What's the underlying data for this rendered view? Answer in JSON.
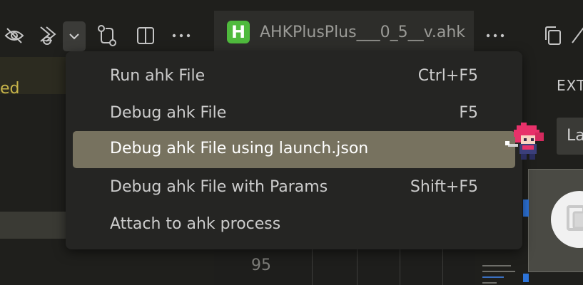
{
  "tab": {
    "badge": "H",
    "filename": "AHKPlusPlus___0_5__v.ahk"
  },
  "menu": {
    "items": [
      {
        "label": "Run ahk File",
        "shortcut": "Ctrl+F5",
        "selected": false
      },
      {
        "label": "Debug ahk File",
        "shortcut": "F5",
        "selected": false
      },
      {
        "label": "Debug ahk File using launch.json",
        "shortcut": "",
        "selected": true
      },
      {
        "label": "Debug ahk File with Params",
        "shortcut": "Shift+F5",
        "selected": false
      },
      {
        "label": "Attach to ahk process",
        "shortcut": "",
        "selected": false
      }
    ]
  },
  "editor": {
    "visible_line_number": "95",
    "left_partial_text": "ed"
  },
  "right_panel": {
    "header_partial": "EXT",
    "input_partial": "La"
  },
  "toolbar": {
    "icons": [
      "eye-off-icon",
      "run-debug-icon",
      "chevron-down-icon",
      "git-compare-icon",
      "split-editor-icon",
      "more-actions-icon"
    ]
  },
  "colors": {
    "background": "#1f1f1c",
    "menu_bg": "#252523",
    "selected_bg": "#77725f",
    "badge_green": "#4fba3d",
    "accent_yellow": "#c8b54a",
    "accent_blue": "#2d74da"
  }
}
